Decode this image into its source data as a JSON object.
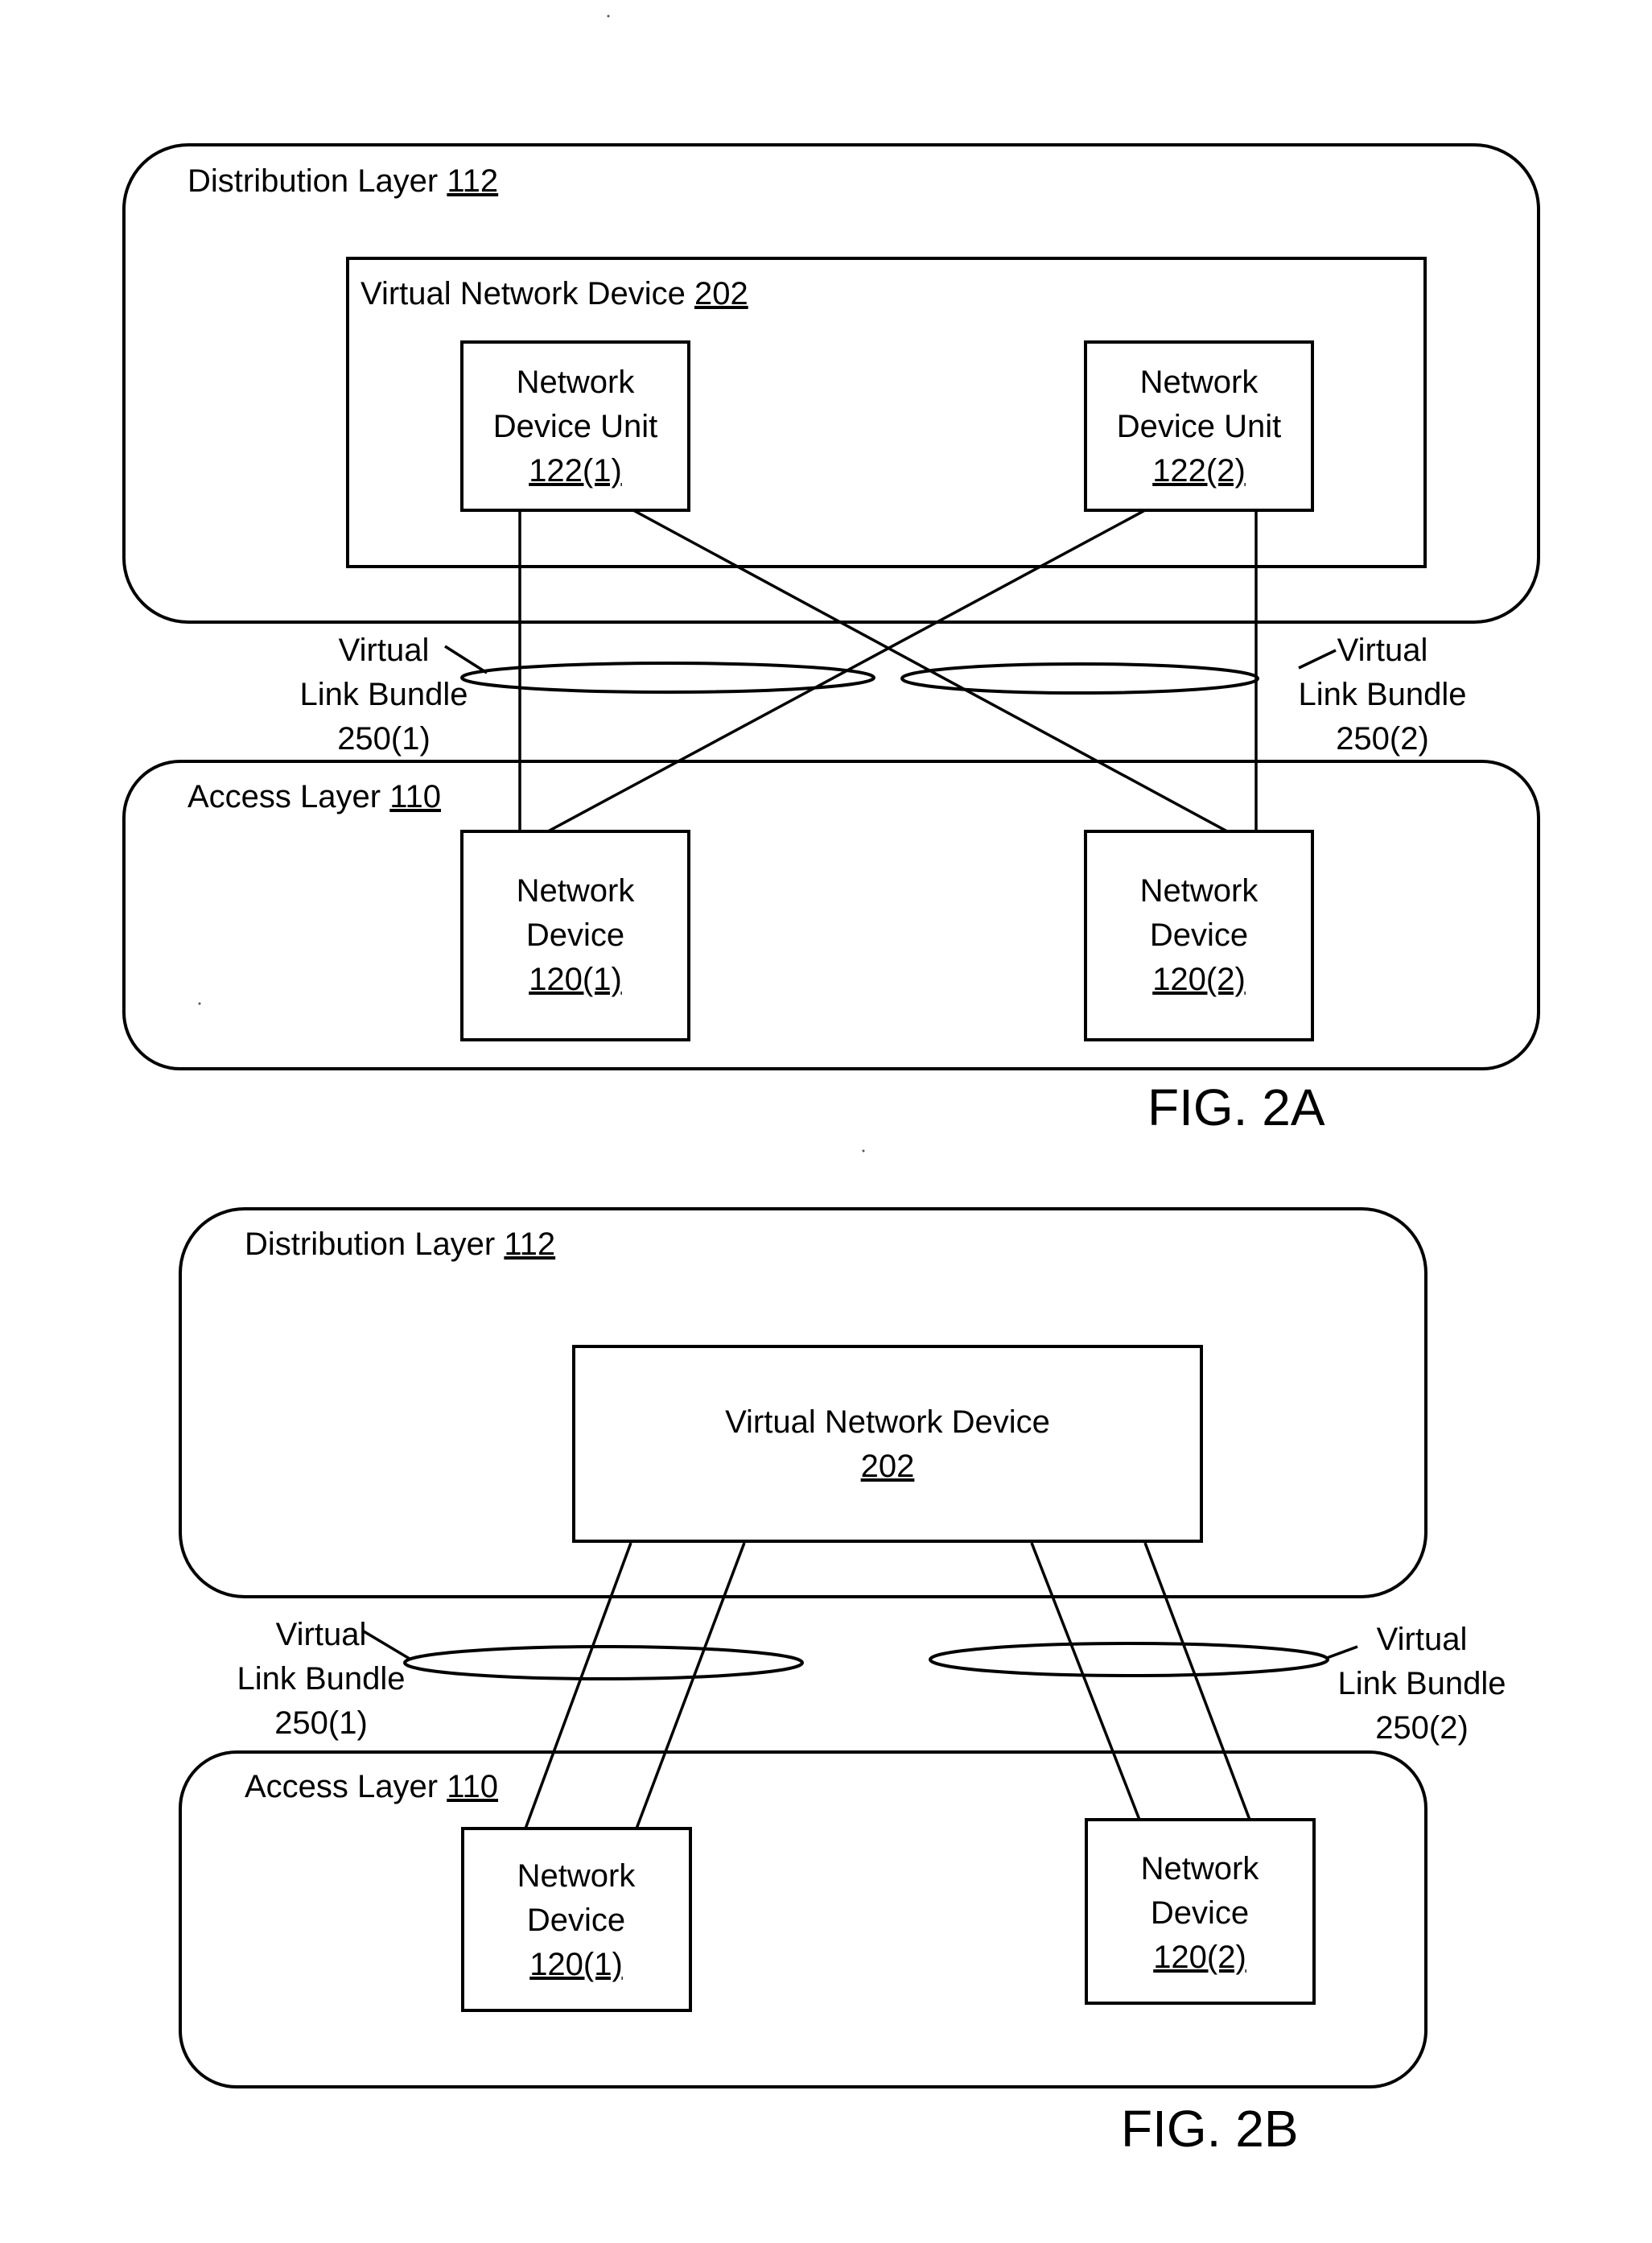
{
  "figures": {
    "fig2a": {
      "caption": "FIG. 2A",
      "distribution_layer": {
        "label": "Distribution Layer",
        "ref": "112"
      },
      "virtual_network_device": {
        "label": "Virtual Network Device",
        "ref": "202"
      },
      "units": [
        {
          "line1": "Network",
          "line2": "Device Unit",
          "ref": "122(1)"
        },
        {
          "line1": "Network",
          "line2": "Device Unit",
          "ref": "122(2)"
        }
      ],
      "access_layer": {
        "label": "Access Layer",
        "ref": "110"
      },
      "devices": [
        {
          "line1": "Network",
          "line2": "Device",
          "ref": "120(1)"
        },
        {
          "line1": "Network",
          "line2": "Device",
          "ref": "120(2)"
        }
      ],
      "bundles": [
        {
          "line1": "Virtual",
          "line2": "Link Bundle",
          "ref": "250(1)"
        },
        {
          "line1": "Virtual",
          "line2": "Link Bundle",
          "ref": "250(2)"
        }
      ]
    },
    "fig2b": {
      "caption": "FIG. 2B",
      "distribution_layer": {
        "label": "Distribution Layer",
        "ref": "112"
      },
      "virtual_network_device": {
        "label": "Virtual Network Device",
        "ref": "202"
      },
      "access_layer": {
        "label": "Access Layer",
        "ref": "110"
      },
      "devices": [
        {
          "line1": "Network",
          "line2": "Device",
          "ref": "120(1)"
        },
        {
          "line1": "Network",
          "line2": "Device",
          "ref": "120(2)"
        }
      ],
      "bundles": [
        {
          "line1": "Virtual",
          "line2": "Link Bundle",
          "ref": "250(1)"
        },
        {
          "line1": "Virtual",
          "line2": "Link Bundle",
          "ref": "250(2)"
        }
      ]
    }
  }
}
